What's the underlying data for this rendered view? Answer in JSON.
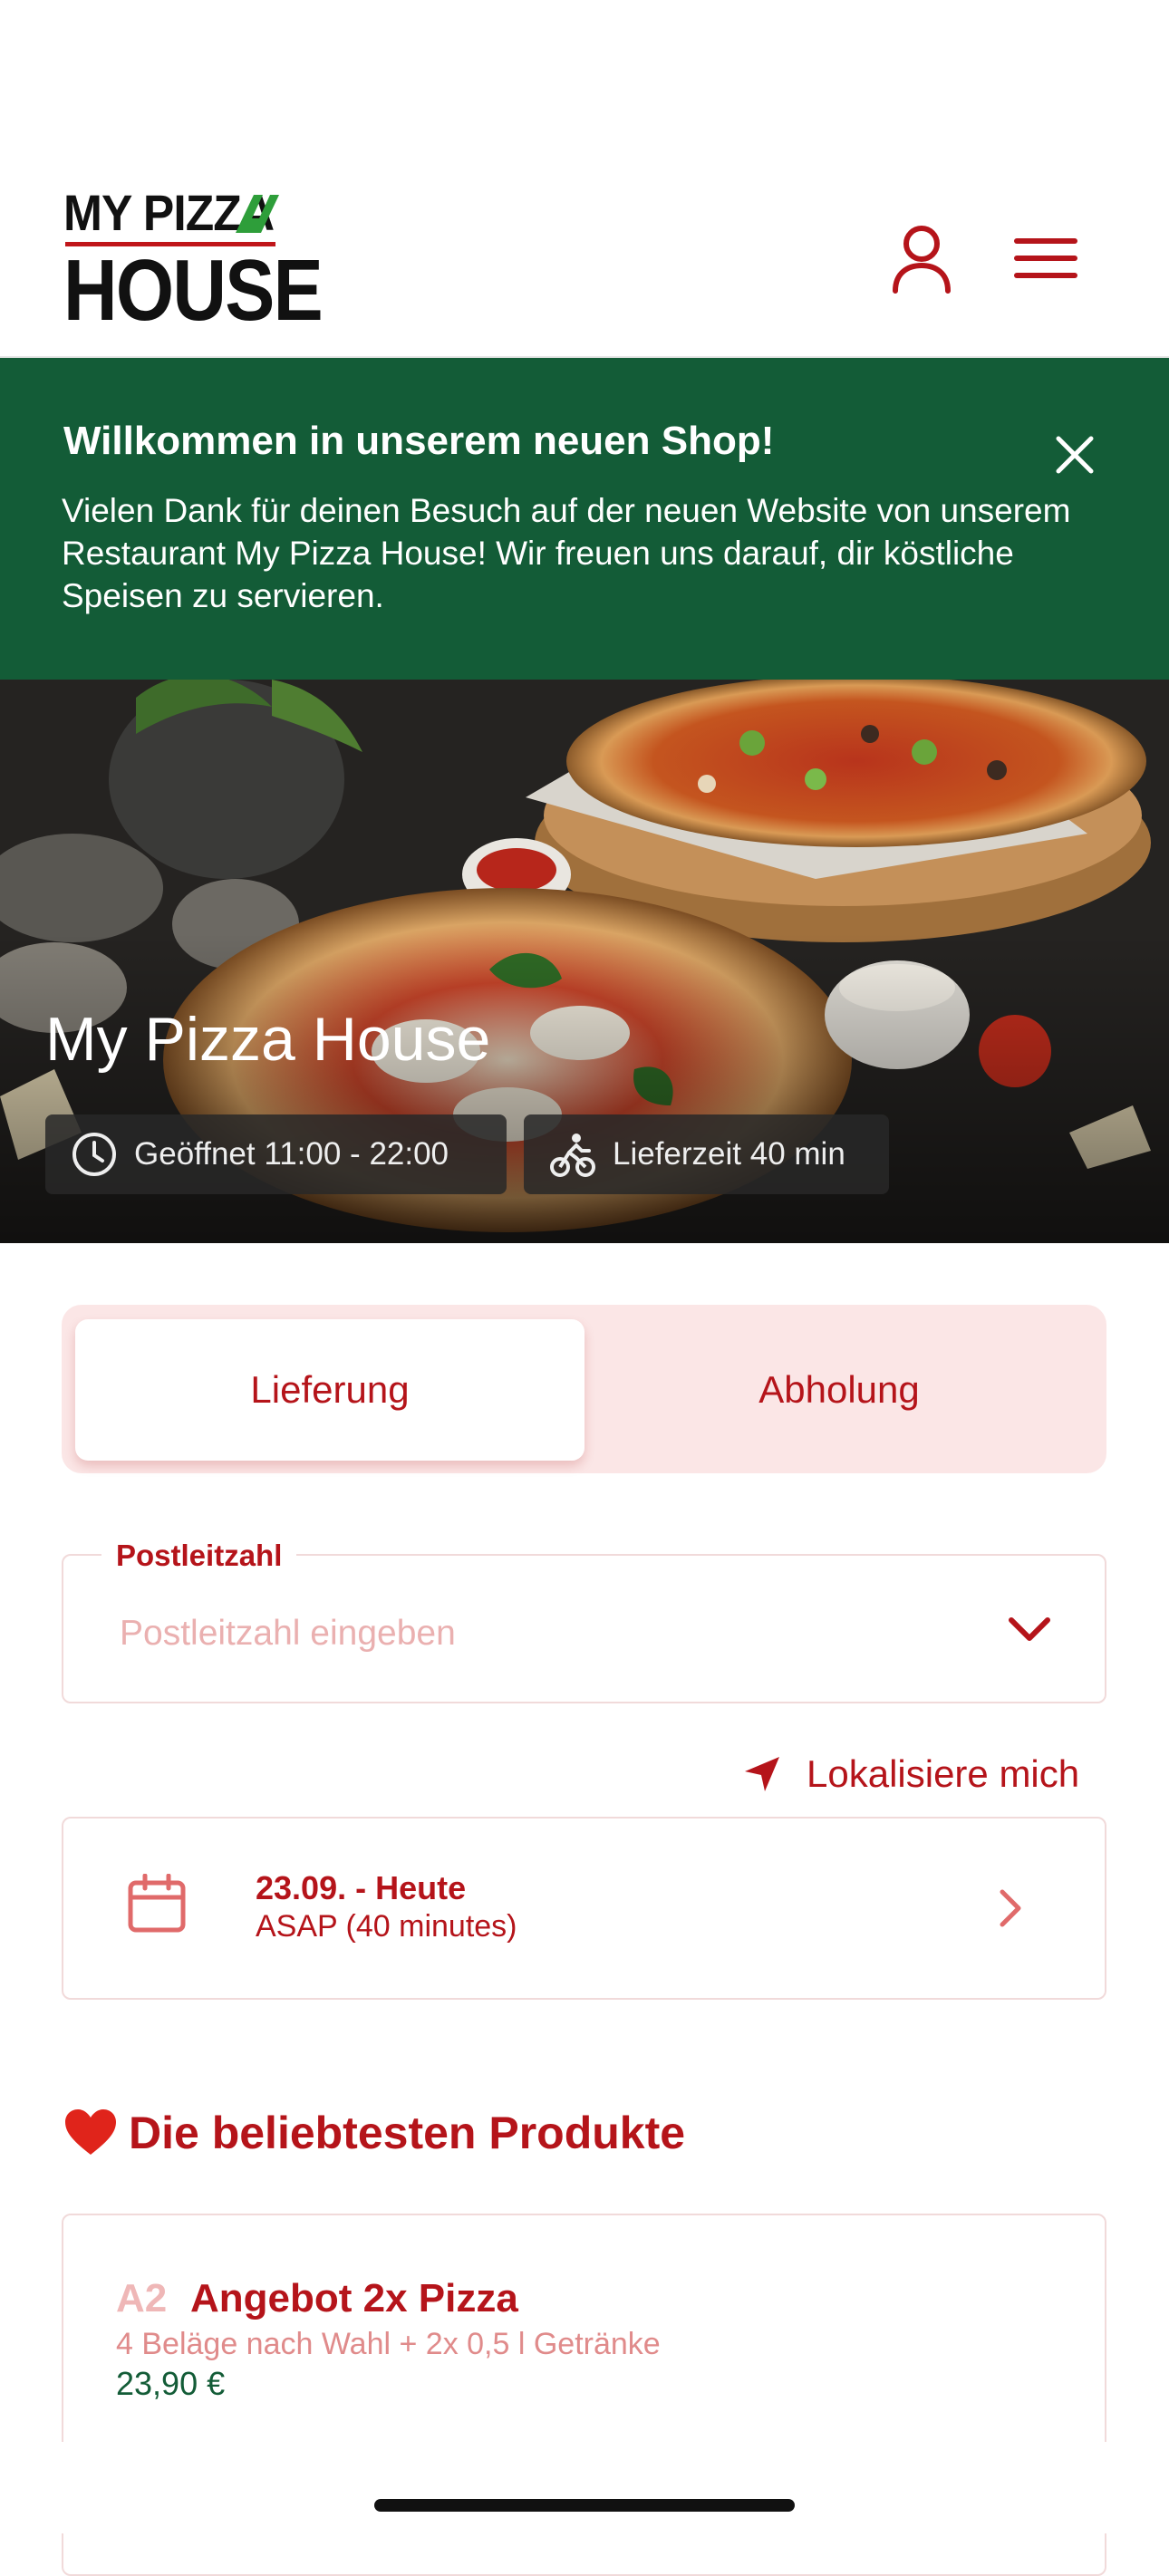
{
  "header": {
    "logo_top": "MY PIZZA",
    "logo_bottom": "HOUSE"
  },
  "banner": {
    "title": "Willkommen in unserem neuen Shop!",
    "text": "Vielen Dank für deinen Besuch auf der neuen Website von unserem Restaurant My Pizza House! Wir freuen uns darauf, dir köstliche Speisen zu servieren."
  },
  "hero": {
    "title": "My Pizza House",
    "open_hours": "Geöffnet 11:00 - 22:00",
    "delivery_time": "Lieferzeit 40 min"
  },
  "order_mode": {
    "tabs": [
      "Lieferung",
      "Abholung"
    ],
    "selected": "Lieferung"
  },
  "postcode": {
    "label": "Postleitzahl",
    "placeholder": "Postleitzahl eingeben",
    "value": ""
  },
  "locate": {
    "label": "Lokalisiere mich"
  },
  "schedule": {
    "date": "23.09. - Heute",
    "time": "ASAP (40 minutes)"
  },
  "popular": {
    "title": "Die beliebtesten Produkte",
    "products": [
      {
        "code": "A2",
        "name": "Angebot 2x Pizza",
        "description": "4 Beläge nach Wahl + 2x 0,5 l Getränke",
        "price": "23,90 €"
      }
    ]
  },
  "colors": {
    "brand_red": "#b5141a",
    "banner_green": "#135c37",
    "toggle_bg": "#fbe6e6",
    "logo_accent_green": "#2e9e3a"
  },
  "icons": [
    "user-icon",
    "menu-icon",
    "close-icon",
    "clock-icon",
    "cyclist-icon",
    "chevron-down-icon",
    "location-arrow-icon",
    "calendar-icon",
    "chevron-right-icon",
    "heart-icon"
  ]
}
